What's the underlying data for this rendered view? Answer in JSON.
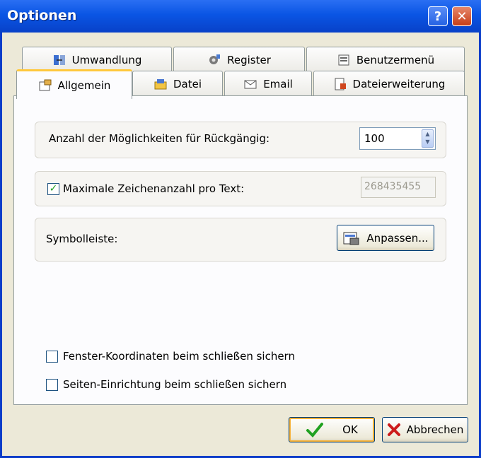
{
  "window": {
    "title": "Optionen",
    "help_glyph": "?",
    "close_glyph": "✕"
  },
  "tabs": {
    "row_back": [
      {
        "label": "Umwandlung",
        "icon": "convert-icon"
      },
      {
        "label": "Register",
        "icon": "register-icon"
      },
      {
        "label": "Benutzermenü",
        "icon": "user-menu-icon"
      }
    ],
    "row_front": [
      {
        "label": "Allgemein",
        "icon": "general-settings-icon",
        "active": true
      },
      {
        "label": "Datei",
        "icon": "file-icon"
      },
      {
        "label": "Email",
        "icon": "email-icon"
      },
      {
        "label": "Dateierweiterung",
        "icon": "file-extension-icon"
      }
    ]
  },
  "general": {
    "undo_label": "Anzahl der Möglichkeiten für Rückgängig:",
    "undo_value": "100",
    "max_chars_label": "Maximale Zeichenanzahl pro Text:",
    "max_chars_checked": true,
    "max_chars_value": "268435455",
    "toolbar_label": "Symbolleiste:",
    "customize_button": "Anpassen...",
    "save_window_coords_label": "Fenster-Koordinaten beim schließen sichern",
    "save_window_coords_checked": false,
    "save_page_setup_label": "Seiten-Einrichtung beim schließen sichern",
    "save_page_setup_checked": false
  },
  "footer": {
    "ok_label": "OK",
    "cancel_label": "Abbrechen"
  },
  "colors": {
    "titlebar": "#0a55e4",
    "ok_check": "#21a121",
    "cancel_x": "#cc1b1b",
    "active_tab_accent": "#ffc83c"
  }
}
